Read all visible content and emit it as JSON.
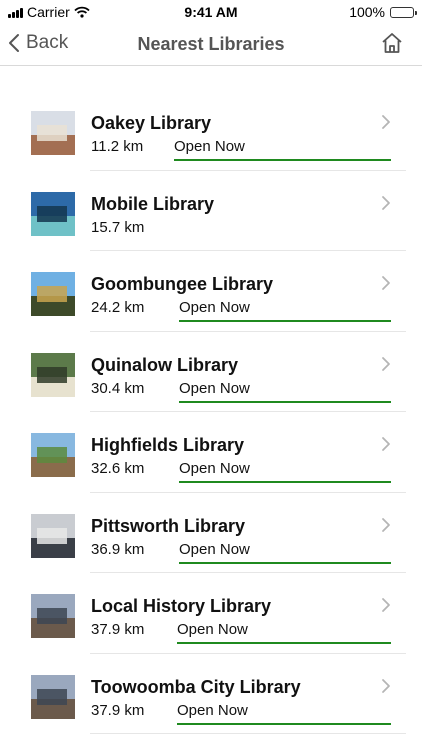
{
  "status_bar": {
    "carrier": "Carrier",
    "time": "9:41 AM",
    "battery": "100%",
    "battery_level": 1.0
  },
  "nav": {
    "back_label": "Back",
    "title": "Nearest Libraries",
    "home_icon": "home-icon"
  },
  "accent_color": "#1f8a1f",
  "libraries": [
    {
      "name": "Oakey Library",
      "distance": "11.2 km",
      "status": "Open Now",
      "thumb_palette": [
        "#d9dee6",
        "#a36f53",
        "#e9e2d4"
      ]
    },
    {
      "name": "Mobile Library",
      "distance": "15.7 km",
      "status": "",
      "thumb_palette": [
        "#2d6aa8",
        "#6fc1c7",
        "#14364f"
      ]
    },
    {
      "name": "Goombungee Library",
      "distance": "24.2 km",
      "status": "Open Now",
      "thumb_palette": [
        "#6fb0e3",
        "#3d4a2a",
        "#c9a54f"
      ]
    },
    {
      "name": "Quinalow Library",
      "distance": "30.4 km",
      "status": "Open Now",
      "thumb_palette": [
        "#5c7a4a",
        "#e7e2cf",
        "#2f3b28"
      ]
    },
    {
      "name": "Highfields Library",
      "distance": "32.6 km",
      "status": "Open Now",
      "thumb_palette": [
        "#88b8e0",
        "#8a6c4c",
        "#5c8b3e"
      ]
    },
    {
      "name": "Pittsworth Library",
      "distance": "36.9 km",
      "status": "Open Now",
      "thumb_palette": [
        "#c9ccd1",
        "#3a3f47",
        "#e7e7e7"
      ]
    },
    {
      "name": "Local History Library",
      "distance": "37.9 km",
      "status": "Open Now",
      "thumb_palette": [
        "#9aa8be",
        "#6b5a4c",
        "#3d4654"
      ]
    },
    {
      "name": "Toowoomba City Library",
      "distance": "37.9 km",
      "status": "Open Now",
      "thumb_palette": [
        "#9aa8be",
        "#6b5a4c",
        "#3d4654"
      ]
    }
  ]
}
